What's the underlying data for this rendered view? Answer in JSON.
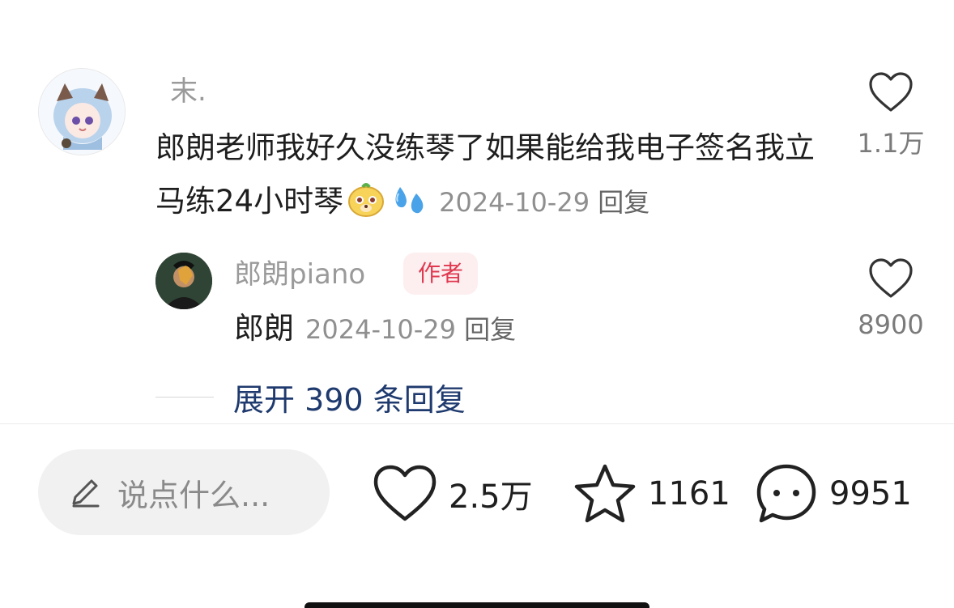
{
  "comment": {
    "username": "末.",
    "text": "郎朗老师我好久没练琴了如果能给我电子签名我立马练24小时琴",
    "date": "2024-10-29",
    "reply_label": "回复",
    "like_count": "1.1万",
    "emoji_icons": [
      "dog-face-icon",
      "sweat-drops-icon"
    ]
  },
  "reply": {
    "username": "郎朗piano",
    "badge": "作者",
    "text": "郎朗",
    "date": "2024-10-29",
    "reply_label": "回复",
    "like_count": "8900"
  },
  "expand_replies": "展开 390 条回复",
  "bottom_bar": {
    "input_placeholder": "说点什么...",
    "likes": "2.5万",
    "favorites": "1161",
    "comments": "9951"
  },
  "colors": {
    "badge_text": "#e0394f",
    "badge_bg": "#fdeef0",
    "link": "#1f3a6e"
  }
}
